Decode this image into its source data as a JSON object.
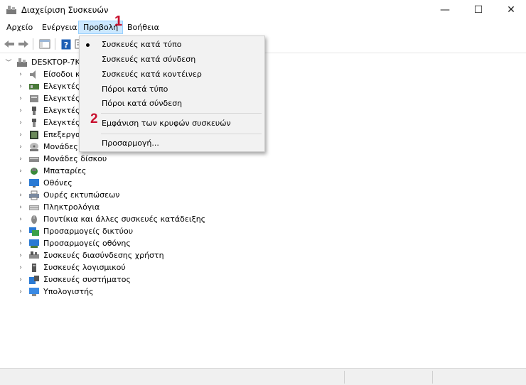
{
  "window": {
    "title": "Διαχείριση Συσκευών",
    "controls": {
      "minimize": "—",
      "maximize": "☐",
      "close": "✕"
    }
  },
  "menubar": {
    "items": [
      "Αρχείο",
      "Ενέργεια",
      "Προβολή",
      "Βοήθεια"
    ],
    "active": "Προβολή"
  },
  "view_menu": {
    "items": [
      "Συσκευές κατά τύπο",
      "Συσκευές κατά σύνδεση",
      "Συσκευές κατά κοντέινερ",
      "Πόροι κατά τύπο",
      "Πόροι κατά σύνδεση",
      "Εμφάνιση των κρυφών συσκευών",
      "Προσαρμογή..."
    ],
    "checked": "Συσκευές κατά τύπο"
  },
  "annotations": {
    "step1": "1",
    "step2": "2"
  },
  "tree": {
    "root": "DESKTOP-7KV",
    "items": [
      "Είσοδοι κ",
      "Ελεγκτές I",
      "Ελεγκτές",
      "Ελεγκτές",
      "Ελεγκτές",
      "Επεξεργα",
      "Μονάδες",
      "Μονάδες δίσκου",
      "Μπαταρίες",
      "Οθόνες",
      "Ουρές εκτυπώσεων",
      "Πληκτρολόγια",
      "Ποντίκια και άλλες συσκευές κατάδειξης",
      "Προσαρμογείς δικτύου",
      "Προσαρμογείς οθόνης",
      "Συσκευές διασύνδεσης χρήστη",
      "Συσκευές λογισμικού",
      "Συσκευές συστήματος",
      "Υπολογιστής"
    ]
  },
  "colors": {
    "menu_highlight": "#cce8ff",
    "annotation_red": "#c8102e",
    "help_blue": "#1e5fb4"
  }
}
